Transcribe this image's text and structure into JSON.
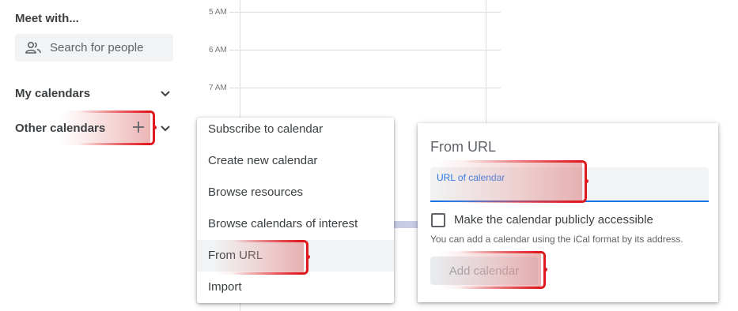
{
  "sidebar": {
    "meet_title": "Meet with...",
    "search_placeholder": "Search for people",
    "my_calendars": "My calendars",
    "other_calendars": "Other calendars"
  },
  "grid": {
    "times": [
      "5 AM",
      "6 AM",
      "7 AM"
    ]
  },
  "menu": {
    "items": [
      {
        "label": "Subscribe to calendar"
      },
      {
        "label": "Create new calendar"
      },
      {
        "label": "Browse resources"
      },
      {
        "label": "Browse calendars of interest"
      },
      {
        "label": "From URL",
        "selected": true
      },
      {
        "label": "Import"
      }
    ]
  },
  "panel": {
    "title": "From URL",
    "url_label": "URL of calendar",
    "public_checkbox_label": "Make the calendar publicly accessible",
    "public_checked": false,
    "hint": "You can add a calendar using the iCal format by its address.",
    "add_button": "Add calendar"
  },
  "colors": {
    "accent": "#1a73e8",
    "highlight": "#e0191f"
  }
}
